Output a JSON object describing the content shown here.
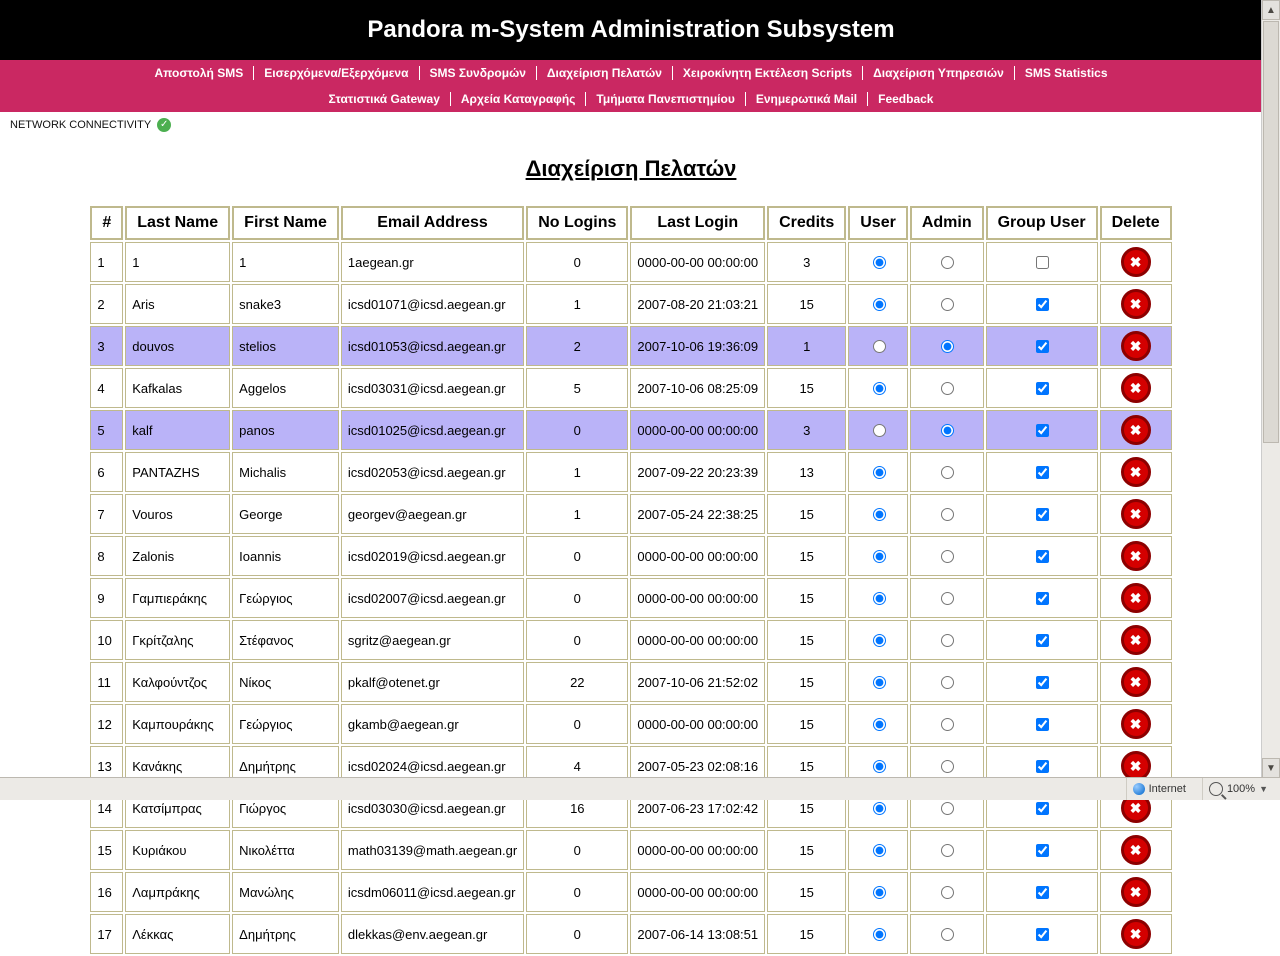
{
  "header": {
    "title": "Pandora m-System Administration Subsystem"
  },
  "nav": {
    "row1": [
      "Αποστολή SMS",
      "Εισερχόμενα/Εξερχόμενα",
      "SMS Συνδρομών",
      "Διαχείριση Πελατών",
      "Χειροκίνητη Εκτέλεση Scripts",
      "Διαχείριση Υπηρεσιών",
      "SMS Statistics"
    ],
    "row2": [
      "Στατιστικά Gateway",
      "Αρχεία Καταγραφής",
      "Τμήματα Πανεπιστημίου",
      "Ενημερωτικά Mail",
      "Feedback"
    ]
  },
  "network_label": "NETWORK CONNECTIVITY",
  "page_title": "Διαχείριση Πελατών",
  "columns": [
    "#",
    "Last Name",
    "First Name",
    "Email Address",
    "No Logins",
    "Last Login",
    "Credits",
    "User",
    "Admin",
    "Group User",
    "Delete"
  ],
  "rows": [
    {
      "n": 1,
      "last": "1",
      "first": "1",
      "email": "1aegean.gr",
      "logins": 0,
      "lastlogin": "0000-00-00 00:00:00",
      "credits": 3,
      "user": true,
      "admin": false,
      "group": false,
      "hl": false
    },
    {
      "n": 2,
      "last": "Aris",
      "first": "snake3",
      "email": "icsd01071@icsd.aegean.gr",
      "logins": 1,
      "lastlogin": "2007-08-20 21:03:21",
      "credits": 15,
      "user": true,
      "admin": false,
      "group": true,
      "hl": false
    },
    {
      "n": 3,
      "last": "douvos",
      "first": "stelios",
      "email": "icsd01053@icsd.aegean.gr",
      "logins": 2,
      "lastlogin": "2007-10-06 19:36:09",
      "credits": 1,
      "user": false,
      "admin": true,
      "group": true,
      "hl": true
    },
    {
      "n": 4,
      "last": "Kafkalas",
      "first": "Aggelos",
      "email": "icsd03031@icsd.aegean.gr",
      "logins": 5,
      "lastlogin": "2007-10-06 08:25:09",
      "credits": 15,
      "user": true,
      "admin": false,
      "group": true,
      "hl": false
    },
    {
      "n": 5,
      "last": "kalf",
      "first": "panos",
      "email": "icsd01025@icsd.aegean.gr",
      "logins": 0,
      "lastlogin": "0000-00-00 00:00:00",
      "credits": 3,
      "user": false,
      "admin": true,
      "group": true,
      "hl": true
    },
    {
      "n": 6,
      "last": "PANTAZHS",
      "first": "Michalis",
      "email": "icsd02053@icsd.aegean.gr",
      "logins": 1,
      "lastlogin": "2007-09-22 20:23:39",
      "credits": 13,
      "user": true,
      "admin": false,
      "group": true,
      "hl": false
    },
    {
      "n": 7,
      "last": "Vouros",
      "first": "George",
      "email": "georgev@aegean.gr",
      "logins": 1,
      "lastlogin": "2007-05-24 22:38:25",
      "credits": 15,
      "user": true,
      "admin": false,
      "group": true,
      "hl": false
    },
    {
      "n": 8,
      "last": "Zalonis",
      "first": "Ioannis",
      "email": "icsd02019@icsd.aegean.gr",
      "logins": 0,
      "lastlogin": "0000-00-00 00:00:00",
      "credits": 15,
      "user": true,
      "admin": false,
      "group": true,
      "hl": false
    },
    {
      "n": 9,
      "last": "Γαμπιεράκης",
      "first": "Γεώργιος",
      "email": "icsd02007@icsd.aegean.gr",
      "logins": 0,
      "lastlogin": "0000-00-00 00:00:00",
      "credits": 15,
      "user": true,
      "admin": false,
      "group": true,
      "hl": false
    },
    {
      "n": 10,
      "last": "Γκρίτζαλης",
      "first": "Στέφανος",
      "email": "sgritz@aegean.gr",
      "logins": 0,
      "lastlogin": "0000-00-00 00:00:00",
      "credits": 15,
      "user": true,
      "admin": false,
      "group": true,
      "hl": false
    },
    {
      "n": 11,
      "last": "Καλφούντζος",
      "first": "Νίκος",
      "email": "pkalf@otenet.gr",
      "logins": 22,
      "lastlogin": "2007-10-06 21:52:02",
      "credits": 15,
      "user": true,
      "admin": false,
      "group": true,
      "hl": false
    },
    {
      "n": 12,
      "last": "Καμπουράκης",
      "first": "Γεώργιος",
      "email": "gkamb@aegean.gr",
      "logins": 0,
      "lastlogin": "0000-00-00 00:00:00",
      "credits": 15,
      "user": true,
      "admin": false,
      "group": true,
      "hl": false
    },
    {
      "n": 13,
      "last": "Κανάκης",
      "first": "Δημήτρης",
      "email": "icsd02024@icsd.aegean.gr",
      "logins": 4,
      "lastlogin": "2007-05-23 02:08:16",
      "credits": 15,
      "user": true,
      "admin": false,
      "group": true,
      "hl": false
    },
    {
      "n": 14,
      "last": "Κατσίμπρας",
      "first": "Γιώργος",
      "email": "icsd03030@icsd.aegean.gr",
      "logins": 16,
      "lastlogin": "2007-06-23 17:02:42",
      "credits": 15,
      "user": true,
      "admin": false,
      "group": true,
      "hl": false
    },
    {
      "n": 15,
      "last": "Κυριάκου",
      "first": "Νικολέττα",
      "email": "math03139@math.aegean.gr",
      "logins": 0,
      "lastlogin": "0000-00-00 00:00:00",
      "credits": 15,
      "user": true,
      "admin": false,
      "group": true,
      "hl": false
    },
    {
      "n": 16,
      "last": "Λαμπράκης",
      "first": "Μανώλης",
      "email": "icsdm06011@icsd.aegean.gr",
      "logins": 0,
      "lastlogin": "0000-00-00 00:00:00",
      "credits": 15,
      "user": true,
      "admin": false,
      "group": true,
      "hl": false
    },
    {
      "n": 17,
      "last": "Λέκκας",
      "first": "Δημήτρης",
      "email": "dlekkas@env.aegean.gr",
      "logins": 0,
      "lastlogin": "2007-06-14 13:08:51",
      "credits": 15,
      "user": true,
      "admin": false,
      "group": true,
      "hl": false
    }
  ],
  "status": {
    "zone": "Internet",
    "zoom": "100%"
  }
}
